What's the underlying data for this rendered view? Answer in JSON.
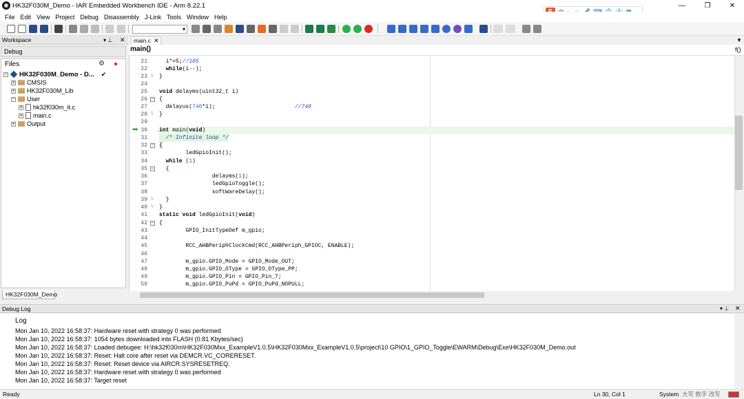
{
  "window": {
    "title": "HK32F030M_Demo - IAR Embedded Workbench IDE - Arm 8.22.1",
    "app_icon": "iar-logo-icon",
    "minimize": "—",
    "maximize": "❐",
    "close": "✕"
  },
  "ime": {
    "logo": "S",
    "items": [
      "中",
      "•,",
      "☺",
      "🎤",
      "⌨",
      "👕",
      "👔",
      "▦"
    ]
  },
  "menu": [
    "File",
    "Edit",
    "View",
    "Project",
    "Debug",
    "Disassembly",
    "J-Link",
    "Tools",
    "Window",
    "Help"
  ],
  "toolbar": {
    "combo_value": ""
  },
  "workspace": {
    "header": "Workspace",
    "pin": "▾ ⊥",
    "close": "✕",
    "config": "Debug",
    "files_label": "Files",
    "tree": [
      {
        "label": "HK32F030M_Demo - D...",
        "check": "✔",
        "type": "workspace"
      },
      {
        "label": "CMSIS",
        "type": "folder"
      },
      {
        "label": "HK32F030M_Lib",
        "type": "folder"
      },
      {
        "label": "User",
        "type": "folder"
      },
      {
        "label": "hk32f030m_it.c",
        "type": "file"
      },
      {
        "label": "main.c",
        "type": "file"
      },
      {
        "label": "Output",
        "type": "folder"
      }
    ],
    "bottom_tab": "HK32F030M_Demo"
  },
  "editor": {
    "tab": "main.c",
    "tab_close": "✕",
    "function": "main()",
    "tab_list_icon": "▼",
    "func_list_icon": "f()",
    "lines": [
      {
        "n": "21",
        "t": "  i*=5;//10S"
      },
      {
        "n": "22",
        "t": "  while(i--);"
      },
      {
        "n": "23",
        "t": "}"
      },
      {
        "n": "24",
        "t": ""
      },
      {
        "n": "25",
        "t": "void delayms(uint32_t i)"
      },
      {
        "n": "26",
        "t": "{"
      },
      {
        "n": "27",
        "t": "  delayus(740*i);                        //740"
      },
      {
        "n": "28",
        "t": "}"
      },
      {
        "n": "29",
        "t": ""
      },
      {
        "n": "30",
        "t": "int main(void)"
      },
      {
        "n": "31",
        "t": "  /* Infinite loop */"
      },
      {
        "n": "32",
        "t": "{"
      },
      {
        "n": "33",
        "t": "        ledGpioInit();"
      },
      {
        "n": "34",
        "t": "  while (1)"
      },
      {
        "n": "35",
        "t": "  {"
      },
      {
        "n": "36",
        "t": "                delayms(1);"
      },
      {
        "n": "37",
        "t": "                ledGpioToggle();"
      },
      {
        "n": "38",
        "t": "                softWareDelay();"
      },
      {
        "n": "39",
        "t": "  }"
      },
      {
        "n": "40",
        "t": "}"
      },
      {
        "n": "41",
        "t": "static void ledGpioInit(void)"
      },
      {
        "n": "42",
        "t": "{"
      },
      {
        "n": "43",
        "t": "        GPIO_InitTypeDef m_gpio;"
      },
      {
        "n": "44",
        "t": ""
      },
      {
        "n": "45",
        "t": "        RCC_AHBPeriphClockCmd(RCC_AHBPeriph_GPIOC, ENABLE);"
      },
      {
        "n": "46",
        "t": ""
      },
      {
        "n": "47",
        "t": "        m_gpio.GPIO_Mode = GPIO_Mode_OUT;"
      },
      {
        "n": "48",
        "t": "        m_gpio.GPIO_OType = GPIO_OType_PP;"
      },
      {
        "n": "49",
        "t": "        m_gpio.GPIO_Pin = GPIO_Pin_7;"
      },
      {
        "n": "50",
        "t": "        m_gpio.GPIO_PuPd = GPIO_PuPd_NOPULL;"
      }
    ]
  },
  "debug_log": {
    "header": "Debug Log",
    "pin": "▾ ⊥",
    "close": "✕",
    "col": "Log",
    "lines": [
      "Mon Jan 10, 2022 16:58:37: Hardware reset with strategy 0 was performed",
      "Mon Jan 10, 2022 16:58:37: 1054 bytes downloaded into FLASH (0.81 Kbytes/sec)",
      "Mon Jan 10, 2022 16:58:37: Loaded debugee: H:\\hk32f030m\\HK32F030Mxx_ExampleV1.0.5\\HK32F030Mxx_ExampleV1.0.5\\project\\10 GPIO\\1_GPIO_Toggle\\EWARM\\Debug\\Exe\\HK32F030M_Demo.out",
      "Mon Jan 10, 2022 16:58:37: Reset: Halt core after reset via DEMCR.VC_CORERESET.",
      "Mon Jan 10, 2022 16:58:37: Reset: Reset device via AIRCR.SYSRESETREQ.",
      "Mon Jan 10, 2022 16:58:37: Hardware reset with strategy 0 was performed",
      "Mon Jan 10, 2022 16:58:37: Target reset"
    ]
  },
  "status": {
    "left": "Ready",
    "position": "Ln 30, Col 1",
    "mode": "System",
    "flags": "大写 数字 改写"
  }
}
